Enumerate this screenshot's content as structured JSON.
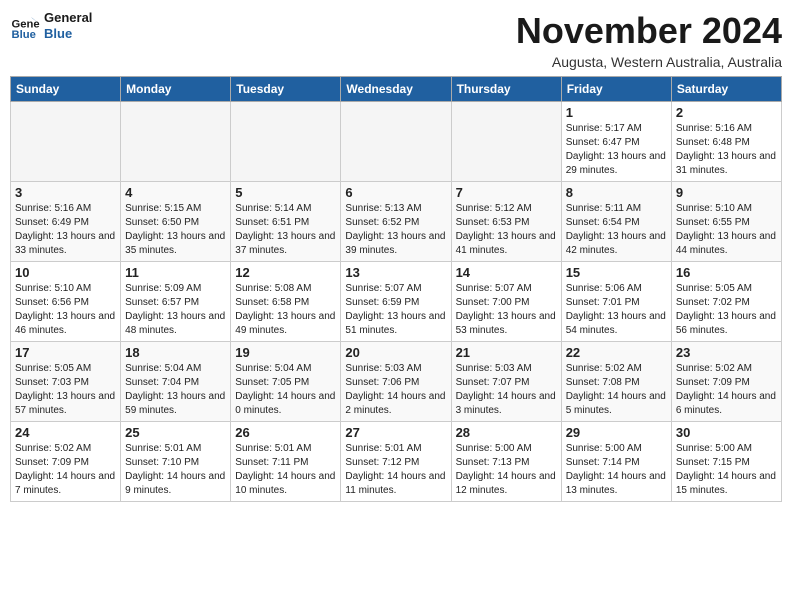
{
  "logo": {
    "line1": "General",
    "line2": "Blue"
  },
  "title": "November 2024",
  "location": "Augusta, Western Australia, Australia",
  "days_of_week": [
    "Sunday",
    "Monday",
    "Tuesday",
    "Wednesday",
    "Thursday",
    "Friday",
    "Saturday"
  ],
  "weeks": [
    [
      {
        "day": "",
        "empty": true
      },
      {
        "day": "",
        "empty": true
      },
      {
        "day": "",
        "empty": true
      },
      {
        "day": "",
        "empty": true
      },
      {
        "day": "",
        "empty": true
      },
      {
        "day": "1",
        "sunrise": "5:17 AM",
        "sunset": "6:47 PM",
        "daylight": "13 hours and 29 minutes."
      },
      {
        "day": "2",
        "sunrise": "5:16 AM",
        "sunset": "6:48 PM",
        "daylight": "13 hours and 31 minutes."
      }
    ],
    [
      {
        "day": "3",
        "sunrise": "5:16 AM",
        "sunset": "6:49 PM",
        "daylight": "13 hours and 33 minutes."
      },
      {
        "day": "4",
        "sunrise": "5:15 AM",
        "sunset": "6:50 PM",
        "daylight": "13 hours and 35 minutes."
      },
      {
        "day": "5",
        "sunrise": "5:14 AM",
        "sunset": "6:51 PM",
        "daylight": "13 hours and 37 minutes."
      },
      {
        "day": "6",
        "sunrise": "5:13 AM",
        "sunset": "6:52 PM",
        "daylight": "13 hours and 39 minutes."
      },
      {
        "day": "7",
        "sunrise": "5:12 AM",
        "sunset": "6:53 PM",
        "daylight": "13 hours and 41 minutes."
      },
      {
        "day": "8",
        "sunrise": "5:11 AM",
        "sunset": "6:54 PM",
        "daylight": "13 hours and 42 minutes."
      },
      {
        "day": "9",
        "sunrise": "5:10 AM",
        "sunset": "6:55 PM",
        "daylight": "13 hours and 44 minutes."
      }
    ],
    [
      {
        "day": "10",
        "sunrise": "5:10 AM",
        "sunset": "6:56 PM",
        "daylight": "13 hours and 46 minutes."
      },
      {
        "day": "11",
        "sunrise": "5:09 AM",
        "sunset": "6:57 PM",
        "daylight": "13 hours and 48 minutes."
      },
      {
        "day": "12",
        "sunrise": "5:08 AM",
        "sunset": "6:58 PM",
        "daylight": "13 hours and 49 minutes."
      },
      {
        "day": "13",
        "sunrise": "5:07 AM",
        "sunset": "6:59 PM",
        "daylight": "13 hours and 51 minutes."
      },
      {
        "day": "14",
        "sunrise": "5:07 AM",
        "sunset": "7:00 PM",
        "daylight": "13 hours and 53 minutes."
      },
      {
        "day": "15",
        "sunrise": "5:06 AM",
        "sunset": "7:01 PM",
        "daylight": "13 hours and 54 minutes."
      },
      {
        "day": "16",
        "sunrise": "5:05 AM",
        "sunset": "7:02 PM",
        "daylight": "13 hours and 56 minutes."
      }
    ],
    [
      {
        "day": "17",
        "sunrise": "5:05 AM",
        "sunset": "7:03 PM",
        "daylight": "13 hours and 57 minutes."
      },
      {
        "day": "18",
        "sunrise": "5:04 AM",
        "sunset": "7:04 PM",
        "daylight": "13 hours and 59 minutes."
      },
      {
        "day": "19",
        "sunrise": "5:04 AM",
        "sunset": "7:05 PM",
        "daylight": "14 hours and 0 minutes."
      },
      {
        "day": "20",
        "sunrise": "5:03 AM",
        "sunset": "7:06 PM",
        "daylight": "14 hours and 2 minutes."
      },
      {
        "day": "21",
        "sunrise": "5:03 AM",
        "sunset": "7:07 PM",
        "daylight": "14 hours and 3 minutes."
      },
      {
        "day": "22",
        "sunrise": "5:02 AM",
        "sunset": "7:08 PM",
        "daylight": "14 hours and 5 minutes."
      },
      {
        "day": "23",
        "sunrise": "5:02 AM",
        "sunset": "7:09 PM",
        "daylight": "14 hours and 6 minutes."
      }
    ],
    [
      {
        "day": "24",
        "sunrise": "5:02 AM",
        "sunset": "7:09 PM",
        "daylight": "14 hours and 7 minutes."
      },
      {
        "day": "25",
        "sunrise": "5:01 AM",
        "sunset": "7:10 PM",
        "daylight": "14 hours and 9 minutes."
      },
      {
        "day": "26",
        "sunrise": "5:01 AM",
        "sunset": "7:11 PM",
        "daylight": "14 hours and 10 minutes."
      },
      {
        "day": "27",
        "sunrise": "5:01 AM",
        "sunset": "7:12 PM",
        "daylight": "14 hours and 11 minutes."
      },
      {
        "day": "28",
        "sunrise": "5:00 AM",
        "sunset": "7:13 PM",
        "daylight": "14 hours and 12 minutes."
      },
      {
        "day": "29",
        "sunrise": "5:00 AM",
        "sunset": "7:14 PM",
        "daylight": "14 hours and 13 minutes."
      },
      {
        "day": "30",
        "sunrise": "5:00 AM",
        "sunset": "7:15 PM",
        "daylight": "14 hours and 15 minutes."
      }
    ]
  ]
}
